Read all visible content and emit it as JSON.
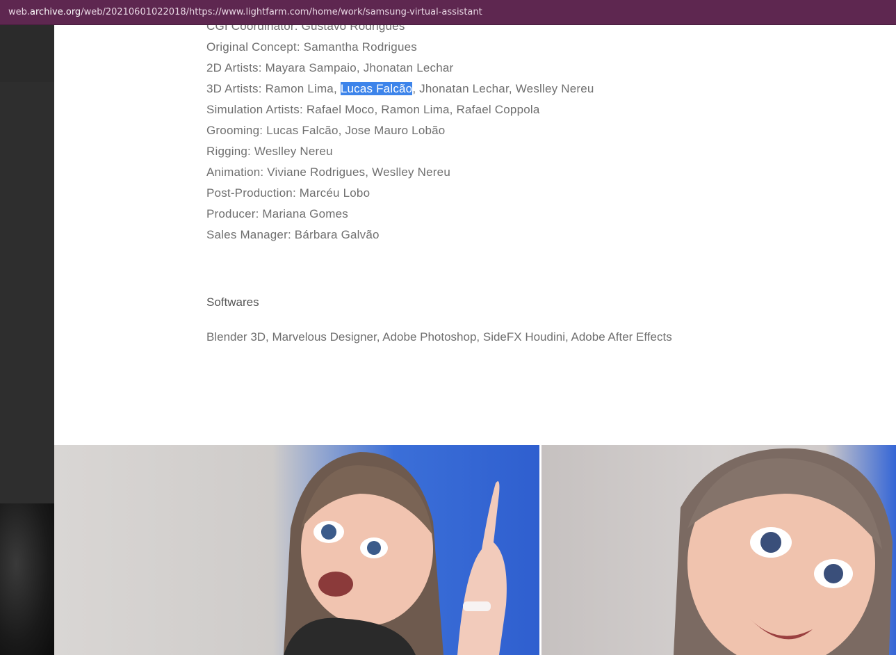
{
  "browser": {
    "url_prefix": "web.",
    "url_domain": "archive.org",
    "url_rest": "/web/20210601022018/https://www.lightfarm.com/home/work/samsung-virtual-assistant"
  },
  "credits": {
    "cgi_coordinator": "CGI Coordinator: Gustavo Rodrigues",
    "original_concept": "Original Concept: Samantha Rodrigues",
    "artists_2d": "2D Artists: Mayara Sampaio, Jhonatan Lechar",
    "artists_3d_prefix": "3D Artists: Ramon Lima, ",
    "artists_3d_selected": "Lucas Falcão",
    "artists_3d_suffix": ", Jhonatan Lechar, Weslley Nereu",
    "simulation": "Simulation Artists: Rafael Moco, Ramon Lima, Rafael Coppola",
    "grooming": "Grooming: Lucas Falcão, Jose Mauro Lobão",
    "rigging": "Rigging: Weslley Nereu",
    "animation": "Animation: Viviane Rodrigues, Weslley Nereu",
    "post_production": "Post-Production: Marcéu Lobo",
    "producer": "Producer: Mariana Gomes",
    "sales_manager": "Sales Manager: Bárbara Galvão"
  },
  "softwares": {
    "title": "Softwares",
    "list": "Blender 3D, Marvelous Designer, Adobe Photoshop, SideFX Houdini, Adobe After Effects"
  },
  "colors": {
    "url_bar": "#5e2750",
    "selection": "#3d84ea",
    "text": "#6f6f6f",
    "left_panel": "#262626"
  }
}
